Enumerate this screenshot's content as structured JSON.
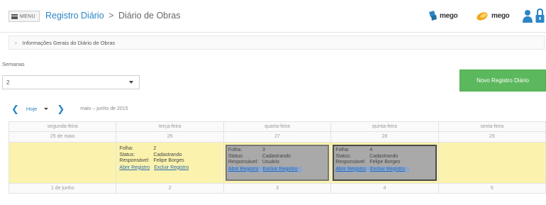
{
  "header": {
    "menu_label": "MENU",
    "app_title": "Registro Diário",
    "separator": ">",
    "page_title": "Diário de Obras",
    "brands": [
      {
        "name": "mego",
        "icon": "mego-logo-icon",
        "color": "#2b86c5"
      },
      {
        "name": "mego",
        "icon": "mego-logo-orange-icon",
        "color": "#f0a61b"
      }
    ]
  },
  "accordion": {
    "chevron": "›",
    "title": "Informações Gerais do Diário de Obras"
  },
  "filters": {
    "semanas_label": "Semanas",
    "semanas_value": "2",
    "novo_button": "Novo Registro Diário"
  },
  "calendar": {
    "prev": "❮",
    "today_label": "Hoje",
    "next": "❯",
    "range_label": "maio – junho de 2015",
    "weekdays": [
      "segunda-feira",
      "terça-feira",
      "quarta-feira",
      "quinta-feira",
      "sexta-feira"
    ],
    "week1_dates": [
      "25 de maio",
      "26",
      "27",
      "28",
      "29"
    ],
    "week2_dates": [
      "1 de junho",
      "2",
      "3",
      "4",
      "5"
    ],
    "events": [
      {
        "day": "terça-feira",
        "folha_label": "Folha:",
        "folha": "2",
        "status_label": "Status:",
        "status": "Cadastrando",
        "resp_label": "Responsável:",
        "resp": "Felipe Borges",
        "open": "Abrir Registro",
        "delete": "Excluir Registro"
      },
      {
        "day": "quarta-feira",
        "folha_label": "Folha:",
        "folha": "3",
        "status_label": "Status:",
        "status": "Cadastrando",
        "resp_label": "Responsável:",
        "resp": "Usuário",
        "open": "Abrir Registro",
        "delete": "Excluir Registro"
      },
      {
        "day": "quinta-feira",
        "folha_label": "Folha:",
        "folha": "4",
        "status_label": "Status:",
        "status": "Cadastrando",
        "resp_label": "Responsável:",
        "resp": "Felipe Borges",
        "open": "Abrir Registro",
        "delete": "Excluir Registro"
      }
    ]
  },
  "colors": {
    "accent": "#2b86c5",
    "success": "#5cb85c",
    "event_yellow": "#fbf3ad",
    "event_gray": "#a9a9a9"
  }
}
